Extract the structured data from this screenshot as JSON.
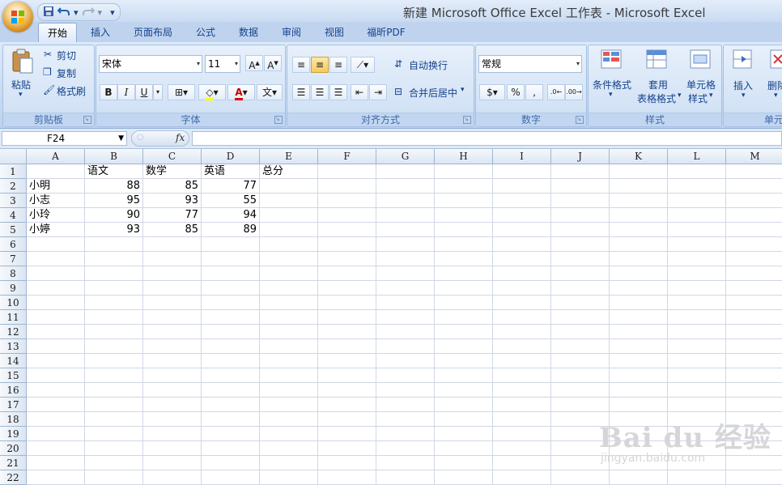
{
  "window": {
    "title": "新建 Microsoft Office Excel 工作表 - Microsoft Excel"
  },
  "quick_access": {
    "items": [
      "save-icon",
      "undo-icon",
      "redo-icon",
      "customize-icon"
    ]
  },
  "tabs": [
    {
      "label": "开始",
      "active": true
    },
    {
      "label": "插入"
    },
    {
      "label": "页面布局"
    },
    {
      "label": "公式"
    },
    {
      "label": "数据"
    },
    {
      "label": "审阅"
    },
    {
      "label": "视图"
    },
    {
      "label": "福昕PDF"
    }
  ],
  "ribbon": {
    "clipboard": {
      "label": "剪贴板",
      "paste": "粘贴",
      "cut": "剪切",
      "copy": "复制",
      "format_painter": "格式刷"
    },
    "font": {
      "label": "字体",
      "font_name": "宋体",
      "font_size": "11",
      "bold": "B",
      "italic": "I",
      "underline": "U",
      "font_color": "A",
      "phonetic": "文"
    },
    "alignment": {
      "label": "对齐方式",
      "wrap_text": "自动换行",
      "merge_center": "合并后居中"
    },
    "number": {
      "label": "数字",
      "format": "常规",
      "percent": "%",
      "comma": ","
    },
    "styles": {
      "label": "样式",
      "conditional": "条件格式",
      "table_line1": "套用",
      "table_line2": "表格格式",
      "cell_line1": "单元格",
      "cell_line2": "样式"
    },
    "cells": {
      "label": "单元",
      "insert": "插入",
      "delete": "删除"
    }
  },
  "formula_bar": {
    "name_box": "F24",
    "fx": "fx",
    "value": ""
  },
  "sheet": {
    "columns": [
      "A",
      "B",
      "C",
      "D",
      "E",
      "F",
      "G",
      "H",
      "I",
      "J",
      "K",
      "L",
      "M"
    ],
    "rows": [
      "1",
      "2",
      "3",
      "4",
      "5",
      "6",
      "7",
      "8",
      "9",
      "10",
      "11",
      "12",
      "13",
      "14",
      "15",
      "16",
      "17",
      "18",
      "19",
      "20",
      "21",
      "22"
    ],
    "header": [
      "",
      "语文",
      "数学",
      "英语",
      "总分"
    ],
    "data": [
      [
        "小明",
        "88",
        "85",
        "77"
      ],
      [
        "小志",
        "95",
        "93",
        "55"
      ],
      [
        "小玲",
        "90",
        "77",
        "94"
      ],
      [
        "小婷",
        "93",
        "85",
        "89"
      ]
    ]
  },
  "watermark": {
    "main": "Bai du 经验",
    "sub": "jingyan.baidu.com"
  },
  "colors": {
    "ribbon": "#c4d8f0",
    "title_bar": "#c9dbf2",
    "accent": "#15428b",
    "gridline": "#d0d7e5"
  }
}
